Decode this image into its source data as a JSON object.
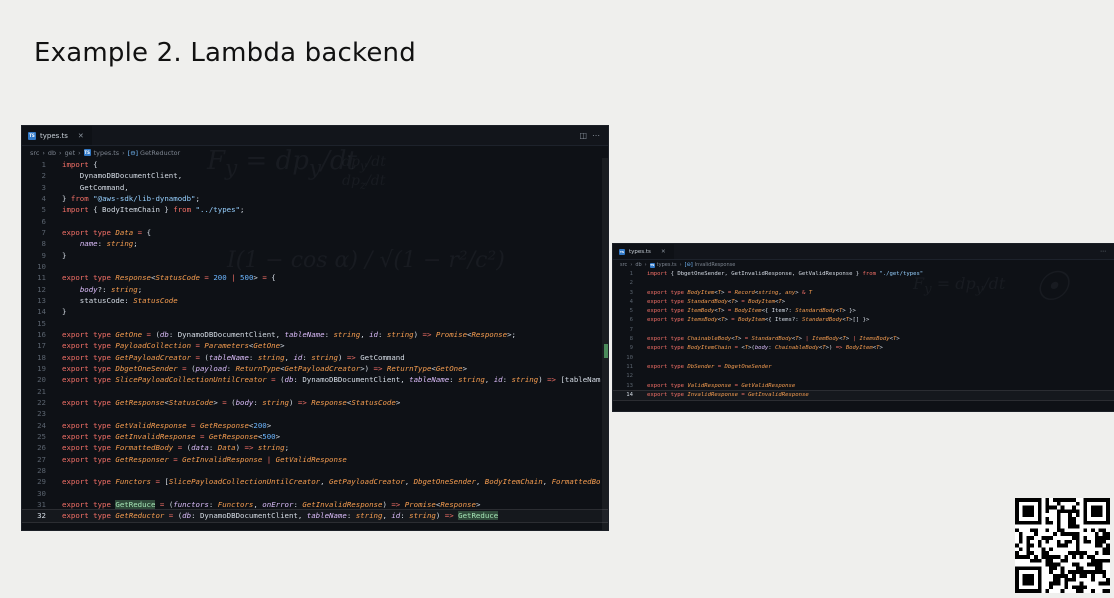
{
  "slide": {
    "title": "Example 2. Lambda backend"
  },
  "editor1": {
    "tab_label": "types.ts",
    "breadcrumb": [
      "src",
      "db",
      "get",
      "types.ts",
      "GetReductor"
    ],
    "lines": [
      [
        [
          "kw",
          "import"
        ],
        [
          "pl",
          " {"
        ]
      ],
      [
        [
          "pl",
          "    DynamoDBDocumentClient,"
        ]
      ],
      [
        [
          "pl",
          "    GetCommand,"
        ]
      ],
      [
        [
          "pl",
          "} "
        ],
        [
          "kw",
          "from"
        ],
        [
          "st",
          " \"@aws-sdk/lib-dynamodb\""
        ],
        [
          "pl",
          ";"
        ]
      ],
      [
        [
          "kw",
          "import"
        ],
        [
          "pl",
          " { BodyItemChain } "
        ],
        [
          "kw",
          "from"
        ],
        [
          "st",
          " \"../types\""
        ],
        [
          "pl",
          ";"
        ]
      ],
      [],
      [
        [
          "kw",
          "export type "
        ],
        [
          "ty",
          "Data"
        ],
        [
          "op",
          " = "
        ],
        [
          "pl",
          "{"
        ]
      ],
      [
        [
          "pl",
          "    "
        ],
        [
          "pr",
          "name"
        ],
        [
          "pl",
          ": "
        ],
        [
          "ty",
          "string"
        ],
        [
          "pl",
          ";"
        ]
      ],
      [
        [
          "pl",
          "}"
        ]
      ],
      [],
      [
        [
          "kw",
          "export type "
        ],
        [
          "ty",
          "Response"
        ],
        [
          "pl",
          "<"
        ],
        [
          "ty",
          "StatusCode"
        ],
        [
          "op",
          " = "
        ],
        [
          "nm",
          "200"
        ],
        [
          "op",
          " | "
        ],
        [
          "nm",
          "500"
        ],
        [
          "pl",
          "> "
        ],
        [
          "op",
          "="
        ],
        [
          "pl",
          " {"
        ]
      ],
      [
        [
          "pl",
          "    "
        ],
        [
          "pr",
          "body"
        ],
        [
          "pl",
          "?: "
        ],
        [
          "ty",
          "string"
        ],
        [
          "pl",
          ";"
        ]
      ],
      [
        [
          "pl",
          "    statusCode: "
        ],
        [
          "ty",
          "StatusCode"
        ]
      ],
      [
        [
          "pl",
          "}"
        ]
      ],
      [],
      [
        [
          "kw",
          "export type "
        ],
        [
          "ty",
          "GetOne"
        ],
        [
          "op",
          " = "
        ],
        [
          "pl",
          "("
        ],
        [
          "pr",
          "db"
        ],
        [
          "pl",
          ": DynamoDBDocumentClient, "
        ],
        [
          "pr",
          "tableName"
        ],
        [
          "pl",
          ": "
        ],
        [
          "ty",
          "string"
        ],
        [
          "pl",
          ", "
        ],
        [
          "pr",
          "id"
        ],
        [
          "pl",
          ": "
        ],
        [
          "ty",
          "string"
        ],
        [
          "pl",
          ") "
        ],
        [
          "op",
          "=>"
        ],
        [
          "pl",
          " "
        ],
        [
          "ty",
          "Promise"
        ],
        [
          "pl",
          "<"
        ],
        [
          "ty",
          "Response"
        ],
        [
          "pl",
          ">;"
        ]
      ],
      [
        [
          "kw",
          "export type "
        ],
        [
          "ty",
          "PayloadCollection"
        ],
        [
          "op",
          " = "
        ],
        [
          "ty",
          "Parameters"
        ],
        [
          "pl",
          "<"
        ],
        [
          "ty",
          "GetOne"
        ],
        [
          "pl",
          ">"
        ]
      ],
      [
        [
          "kw",
          "export type "
        ],
        [
          "ty",
          "GetPayloadCreator"
        ],
        [
          "op",
          " = "
        ],
        [
          "pl",
          "("
        ],
        [
          "pr",
          "tableName"
        ],
        [
          "pl",
          ": "
        ],
        [
          "ty",
          "string"
        ],
        [
          "pl",
          ", "
        ],
        [
          "pr",
          "id"
        ],
        [
          "pl",
          ": "
        ],
        [
          "ty",
          "string"
        ],
        [
          "pl",
          ") "
        ],
        [
          "op",
          "=>"
        ],
        [
          "pl",
          " GetCommand"
        ]
      ],
      [
        [
          "kw",
          "export type "
        ],
        [
          "ty",
          "DbgetOneSender"
        ],
        [
          "op",
          " = "
        ],
        [
          "pl",
          "("
        ],
        [
          "pr",
          "payload"
        ],
        [
          "pl",
          ": "
        ],
        [
          "ty",
          "ReturnType"
        ],
        [
          "pl",
          "<"
        ],
        [
          "ty",
          "GetPayloadCreator"
        ],
        [
          "pl",
          ">) "
        ],
        [
          "op",
          "=>"
        ],
        [
          "pl",
          " "
        ],
        [
          "ty",
          "ReturnType"
        ],
        [
          "pl",
          "<"
        ],
        [
          "ty",
          "GetOne"
        ],
        [
          "pl",
          ">"
        ]
      ],
      [
        [
          "kw",
          "export type "
        ],
        [
          "ty",
          "SlicePayloadCollectionUntilCreator"
        ],
        [
          "op",
          " = "
        ],
        [
          "pl",
          "("
        ],
        [
          "pr",
          "db"
        ],
        [
          "pl",
          ": DynamoDBDocumentClient, "
        ],
        [
          "pr",
          "tableName"
        ],
        [
          "pl",
          ": "
        ],
        [
          "ty",
          "string"
        ],
        [
          "pl",
          ", "
        ],
        [
          "pr",
          "id"
        ],
        [
          "pl",
          ": "
        ],
        [
          "ty",
          "string"
        ],
        [
          "pl",
          ") "
        ],
        [
          "op",
          "=>"
        ],
        [
          "pl",
          " [tableNam"
        ]
      ],
      [],
      [
        [
          "kw",
          "export type "
        ],
        [
          "ty",
          "GetResponse"
        ],
        [
          "pl",
          "<"
        ],
        [
          "ty",
          "StatusCode"
        ],
        [
          "pl",
          ">"
        ],
        [
          "op",
          " = "
        ],
        [
          "pl",
          "("
        ],
        [
          "pr",
          "body"
        ],
        [
          "pl",
          ": "
        ],
        [
          "ty",
          "string"
        ],
        [
          "pl",
          ") "
        ],
        [
          "op",
          "=>"
        ],
        [
          "pl",
          " "
        ],
        [
          "ty",
          "Response"
        ],
        [
          "pl",
          "<"
        ],
        [
          "ty",
          "StatusCode"
        ],
        [
          "pl",
          ">"
        ]
      ],
      [],
      [
        [
          "kw",
          "export type "
        ],
        [
          "ty",
          "GetValidResponse"
        ],
        [
          "op",
          " = "
        ],
        [
          "ty",
          "GetResponse"
        ],
        [
          "pl",
          "<"
        ],
        [
          "nm",
          "200"
        ],
        [
          "pl",
          ">"
        ]
      ],
      [
        [
          "kw",
          "export type "
        ],
        [
          "ty",
          "GetInvalidResponse"
        ],
        [
          "op",
          " = "
        ],
        [
          "ty",
          "GetResponse"
        ],
        [
          "pl",
          "<"
        ],
        [
          "nm",
          "500"
        ],
        [
          "pl",
          ">"
        ]
      ],
      [
        [
          "kw",
          "export type "
        ],
        [
          "ty",
          "FormattedBody"
        ],
        [
          "op",
          " = "
        ],
        [
          "pl",
          "("
        ],
        [
          "pr",
          "data"
        ],
        [
          "pl",
          ": "
        ],
        [
          "ty",
          "Data"
        ],
        [
          "pl",
          ") "
        ],
        [
          "op",
          "=>"
        ],
        [
          "pl",
          " "
        ],
        [
          "ty",
          "string"
        ],
        [
          "pl",
          ";"
        ]
      ],
      [
        [
          "kw",
          "export type "
        ],
        [
          "ty",
          "GetResponser"
        ],
        [
          "op",
          " = "
        ],
        [
          "ty",
          "GetInvalidResponse"
        ],
        [
          "op",
          " | "
        ],
        [
          "ty",
          "GetValidResponse"
        ]
      ],
      [],
      [
        [
          "kw",
          "export type "
        ],
        [
          "ty",
          "Functors"
        ],
        [
          "op",
          " = "
        ],
        [
          "pl",
          "["
        ],
        [
          "ty",
          "SlicePayloadCollectionUntilCreator"
        ],
        [
          "pl",
          ", "
        ],
        [
          "ty",
          "GetPayloadCreator"
        ],
        [
          "pl",
          ", "
        ],
        [
          "ty",
          "DbgetOneSender"
        ],
        [
          "pl",
          ", "
        ],
        [
          "ty",
          "BodyItemChain"
        ],
        [
          "pl",
          ", "
        ],
        [
          "ty",
          "FormattedBo"
        ]
      ],
      [],
      [
        [
          "kw",
          "export type "
        ],
        [
          "hl",
          "GetReduce"
        ],
        [
          "op",
          " = "
        ],
        [
          "pl",
          "("
        ],
        [
          "pr",
          "functors"
        ],
        [
          "pl",
          ": "
        ],
        [
          "ty",
          "Functors"
        ],
        [
          "pl",
          ", "
        ],
        [
          "pr",
          "onError"
        ],
        [
          "pl",
          ": "
        ],
        [
          "ty",
          "GetInvalidResponse"
        ],
        [
          "pl",
          ") "
        ],
        [
          "op",
          "=>"
        ],
        [
          "pl",
          " "
        ],
        [
          "ty",
          "Promise"
        ],
        [
          "pl",
          "<"
        ],
        [
          "ty",
          "Response"
        ],
        [
          "pl",
          ">"
        ]
      ],
      [
        [
          "kw",
          "export type "
        ],
        [
          "ty",
          "GetReductor"
        ],
        [
          "op",
          " = "
        ],
        [
          "pl",
          "("
        ],
        [
          "pr",
          "db"
        ],
        [
          "pl",
          ": DynamoDBDocumentClient, "
        ],
        [
          "pr",
          "tableName"
        ],
        [
          "pl",
          ": "
        ],
        [
          "ty",
          "string"
        ],
        [
          "pl",
          ", "
        ],
        [
          "pr",
          "id"
        ],
        [
          "pl",
          ": "
        ],
        [
          "ty",
          "string"
        ],
        [
          "pl",
          ") "
        ],
        [
          "op",
          "=>"
        ],
        [
          "pl",
          " "
        ],
        [
          "hl",
          "GetReduce"
        ]
      ]
    ],
    "active_line": 32
  },
  "editor2": {
    "tab_label": "types.ts",
    "breadcrumb": [
      "src",
      "db",
      "types.ts",
      "InvalidResponse"
    ],
    "lines": [
      [
        [
          "kw",
          "import"
        ],
        [
          "pl",
          " { DbgetOneSender, GetInvalidResponse, GetValidResponse } "
        ],
        [
          "kw",
          "from"
        ],
        [
          "st",
          " \"./get/types\""
        ]
      ],
      [],
      [
        [
          "kw",
          "export type "
        ],
        [
          "ty",
          "BodyItem"
        ],
        [
          "pl",
          "<"
        ],
        [
          "ty",
          "T"
        ],
        [
          "pl",
          ">"
        ],
        [
          "op",
          " = "
        ],
        [
          "ty",
          "Record"
        ],
        [
          "pl",
          "<"
        ],
        [
          "ty",
          "string"
        ],
        [
          "pl",
          ", "
        ],
        [
          "ty",
          "any"
        ],
        [
          "pl",
          "> "
        ],
        [
          "op",
          "&"
        ],
        [
          "pl",
          " "
        ],
        [
          "ty",
          "T"
        ]
      ],
      [
        [
          "kw",
          "export type "
        ],
        [
          "ty",
          "StandardBody"
        ],
        [
          "pl",
          "<"
        ],
        [
          "ty",
          "T"
        ],
        [
          "pl",
          ">"
        ],
        [
          "op",
          " = "
        ],
        [
          "ty",
          "BodyItem"
        ],
        [
          "pl",
          "<"
        ],
        [
          "ty",
          "T"
        ],
        [
          "pl",
          ">"
        ]
      ],
      [
        [
          "kw",
          "export type "
        ],
        [
          "ty",
          "ItemBody"
        ],
        [
          "pl",
          "<"
        ],
        [
          "ty",
          "T"
        ],
        [
          "pl",
          ">"
        ],
        [
          "op",
          " = "
        ],
        [
          "ty",
          "BodyItem"
        ],
        [
          "pl",
          "<{ Item?: "
        ],
        [
          "ty",
          "StandardBody"
        ],
        [
          "pl",
          "<"
        ],
        [
          "ty",
          "T"
        ],
        [
          "pl",
          "> }>"
        ]
      ],
      [
        [
          "kw",
          "export type "
        ],
        [
          "ty",
          "ItemsBody"
        ],
        [
          "pl",
          "<"
        ],
        [
          "ty",
          "T"
        ],
        [
          "pl",
          ">"
        ],
        [
          "op",
          " = "
        ],
        [
          "ty",
          "BodyItem"
        ],
        [
          "pl",
          "<{ Items?: "
        ],
        [
          "ty",
          "StandardBody"
        ],
        [
          "pl",
          "<"
        ],
        [
          "ty",
          "T"
        ],
        [
          "pl",
          ">[] }>"
        ]
      ],
      [],
      [
        [
          "kw",
          "export type "
        ],
        [
          "ty",
          "ChainableBody"
        ],
        [
          "pl",
          "<"
        ],
        [
          "ty",
          "T"
        ],
        [
          "pl",
          ">"
        ],
        [
          "op",
          " = "
        ],
        [
          "ty",
          "StandardBody"
        ],
        [
          "pl",
          "<"
        ],
        [
          "ty",
          "T"
        ],
        [
          "pl",
          "> "
        ],
        [
          "op",
          "|"
        ],
        [
          "pl",
          " "
        ],
        [
          "ty",
          "ItemBody"
        ],
        [
          "pl",
          "<"
        ],
        [
          "ty",
          "T"
        ],
        [
          "pl",
          "> "
        ],
        [
          "op",
          "|"
        ],
        [
          "pl",
          " "
        ],
        [
          "ty",
          "ItemsBody"
        ],
        [
          "pl",
          "<"
        ],
        [
          "ty",
          "T"
        ],
        [
          "pl",
          ">"
        ]
      ],
      [
        [
          "kw",
          "export type "
        ],
        [
          "ty",
          "BodyItemChain"
        ],
        [
          "op",
          " = "
        ],
        [
          "pl",
          "<"
        ],
        [
          "ty",
          "T"
        ],
        [
          "pl",
          ">("
        ],
        [
          "pr",
          "body"
        ],
        [
          "pl",
          ": "
        ],
        [
          "ty",
          "ChainableBody"
        ],
        [
          "pl",
          "<"
        ],
        [
          "ty",
          "T"
        ],
        [
          "pl",
          ">) "
        ],
        [
          "op",
          "=>"
        ],
        [
          "pl",
          " "
        ],
        [
          "ty",
          "BodyItem"
        ],
        [
          "pl",
          "<"
        ],
        [
          "ty",
          "T"
        ],
        [
          "pl",
          ">"
        ]
      ],
      [],
      [
        [
          "kw",
          "export type "
        ],
        [
          "ty",
          "DbSender"
        ],
        [
          "op",
          " = "
        ],
        [
          "ty",
          "DbgetOneSender"
        ]
      ],
      [],
      [
        [
          "kw",
          "export type "
        ],
        [
          "ty",
          "ValidResponse"
        ],
        [
          "op",
          " = "
        ],
        [
          "ty",
          "GetValidResponse"
        ]
      ],
      [
        [
          "kw",
          "export type "
        ],
        [
          "ty",
          "InvalidResponse"
        ],
        [
          "op",
          " = "
        ],
        [
          "ty",
          "GetInvalidResponse"
        ]
      ]
    ],
    "active_line": 14
  }
}
